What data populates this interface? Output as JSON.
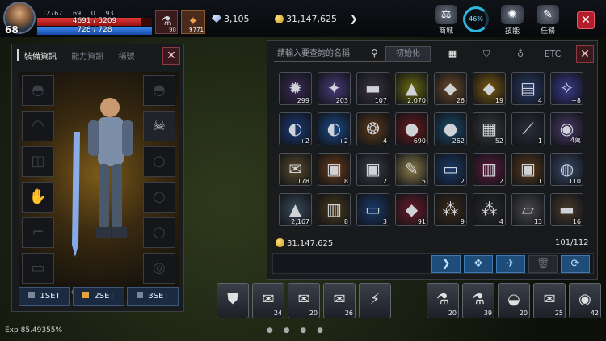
{
  "player": {
    "level": "68",
    "hp": "4691 / 5209",
    "hp_ratio": 0.9,
    "mp": "728 / 728",
    "mp_ratio": 1.0,
    "stat1": "12767",
    "stat2": "69",
    "stat3": "0",
    "stat4": "93"
  },
  "resources": {
    "gem": "3,105",
    "gold": "31,147,625"
  },
  "consumable_slots": [
    {
      "count": "90"
    },
    {
      "count": "9771"
    }
  ],
  "menu": {
    "shop": "商城",
    "pct": "46%",
    "skill": "技能",
    "quest": "任務"
  },
  "equip": {
    "tab_on": "裝備資訊",
    "tab2": "能力資訊",
    "tab3": "稱號",
    "sets": [
      "1SET",
      "2SET",
      "3SET"
    ],
    "set_colors": [
      "#7a8696",
      "#e3a23a",
      "#7a8696"
    ]
  },
  "inventory": {
    "search_placeholder": "請輸入要查詢的名稱",
    "init": "初始化",
    "etc": "ETC",
    "gold": "31,147,625",
    "count": "101/112",
    "items": [
      {
        "g": "✹",
        "bg": "#3a2a56",
        "q": "299"
      },
      {
        "g": "✦",
        "bg": "#4a3a7a",
        "q": "203"
      },
      {
        "g": "▬",
        "bg": "#3a3440",
        "q": "107"
      },
      {
        "g": "▲",
        "bg": "#6a6a10",
        "q": "2,070"
      },
      {
        "g": "◆",
        "bg": "#6a4a2a",
        "q": "26"
      },
      {
        "g": "◆",
        "bg": "#7a5a10",
        "q": "19"
      },
      {
        "g": "▤",
        "bg": "#2a3a6a",
        "q": "4"
      },
      {
        "g": "✧",
        "bg": "#3a3a8a",
        "q": "+8"
      },
      {
        "g": "◐",
        "bg": "#1a3a7a",
        "q": "+2"
      },
      {
        "g": "◐",
        "bg": "#1a4a8a",
        "q": "+2"
      },
      {
        "g": "❂",
        "bg": "#5a3a1a",
        "q": "4"
      },
      {
        "g": "●",
        "bg": "#6a1a1a",
        "q": "690"
      },
      {
        "g": "●",
        "bg": "#1a4a6a",
        "q": "262"
      },
      {
        "g": "▦",
        "bg": "#3a3a3a",
        "q": "52"
      },
      {
        "g": "⟋",
        "bg": "#2a2f3a",
        "q": "1"
      },
      {
        "g": "◉",
        "bg": "#4a3a6a",
        "q": "4萬"
      },
      {
        "g": "✉",
        "bg": "#5a4a2a",
        "q": "178"
      },
      {
        "g": "▣",
        "bg": "#6a3a1a",
        "q": "8"
      },
      {
        "g": "▣",
        "bg": "#3a3d45",
        "q": "2"
      },
      {
        "g": "✎",
        "bg": "#8a7a4a",
        "q": "5"
      },
      {
        "g": "▭",
        "bg": "#1a3a6a",
        "q": "2"
      },
      {
        "g": "▥",
        "bg": "#5a1a3a",
        "q": "2"
      },
      {
        "g": "▣",
        "bg": "#5a3a1a",
        "q": "1"
      },
      {
        "g": "◍",
        "bg": "#3a4a6a",
        "q": "110"
      },
      {
        "g": "▲",
        "bg": "#3a4a5a",
        "q": "2,167"
      },
      {
        "g": "▥",
        "bg": "#4a3a1a",
        "q": "8"
      },
      {
        "g": "▭",
        "bg": "#1a3a6a",
        "q": "3"
      },
      {
        "g": "◆",
        "bg": "#6a1a2a",
        "q": "91"
      },
      {
        "g": "⁂",
        "bg": "#3a2a1a",
        "q": "9"
      },
      {
        "g": "⁂",
        "bg": "#2a2a2a",
        "q": "4"
      },
      {
        "g": "▱",
        "bg": "#4a4a4a",
        "q": "13"
      },
      {
        "g": "▬",
        "bg": "#4a3a2a",
        "q": "16"
      }
    ]
  },
  "hotbar": [
    {
      "g": "⛊",
      "q": ""
    },
    {
      "g": "✉",
      "q": "24"
    },
    {
      "g": "✉",
      "q": "20"
    },
    {
      "g": "✉",
      "q": "26"
    },
    {
      "g": "⚡",
      "q": ""
    },
    {
      "g": "⚗",
      "q": "20"
    },
    {
      "g": "⚗",
      "q": "39"
    },
    {
      "g": "◒",
      "q": "20"
    },
    {
      "g": "✉",
      "q": "25"
    },
    {
      "g": "◉",
      "q": "42"
    }
  ],
  "exp": "Exp 85.49355%"
}
